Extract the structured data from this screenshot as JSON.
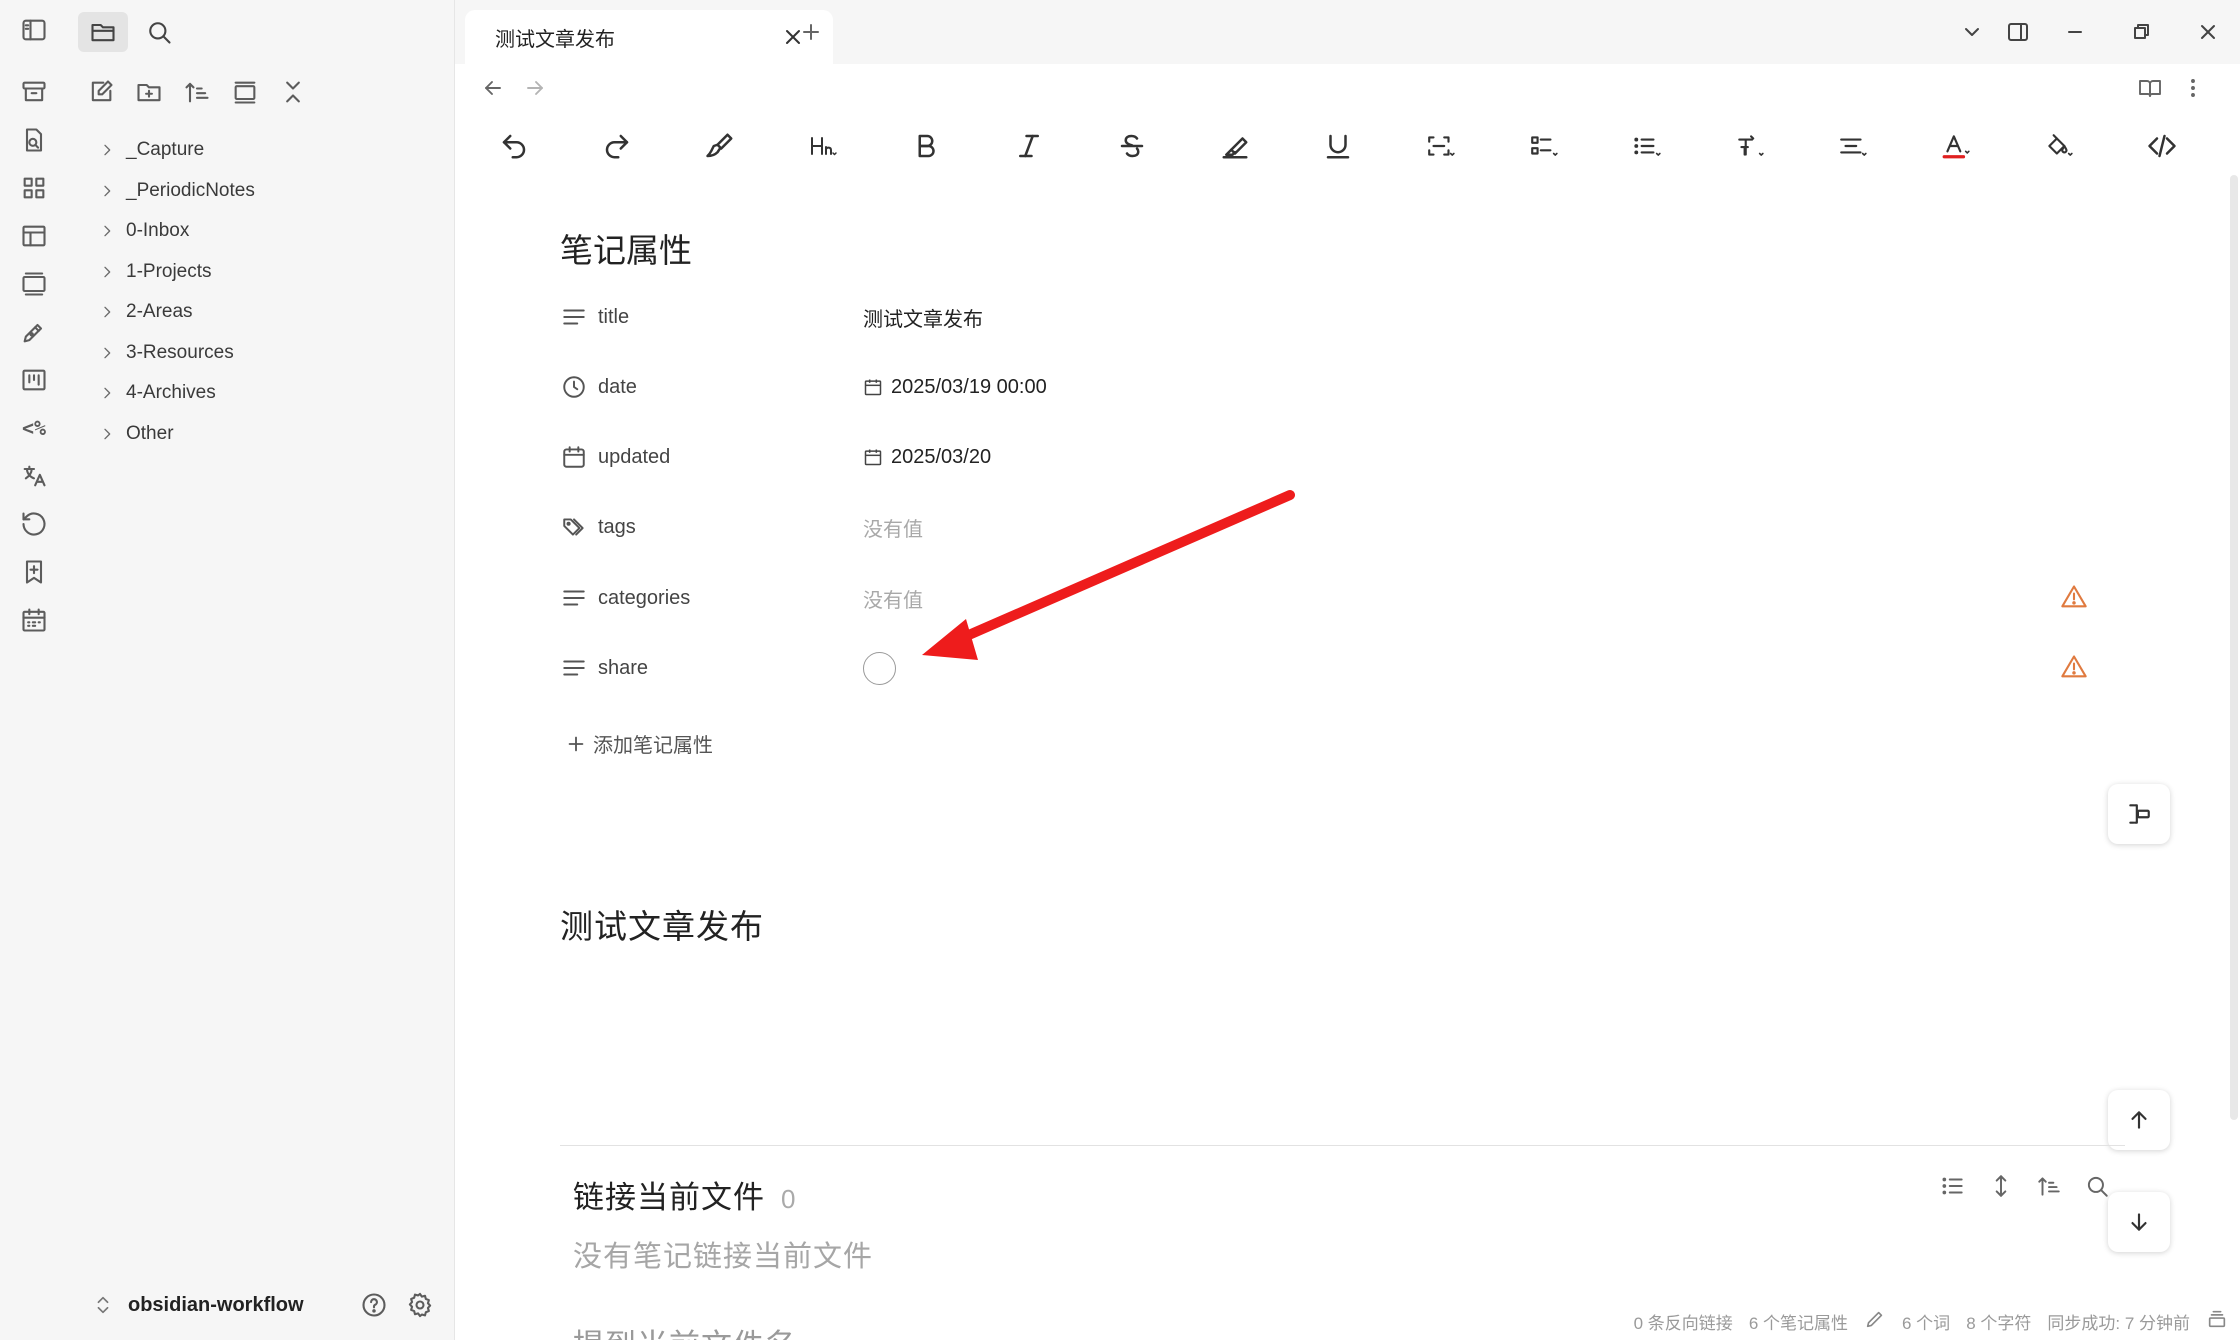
{
  "sidebar": {
    "tree": [
      {
        "label": "_Capture"
      },
      {
        "label": "_PeriodicNotes"
      },
      {
        "label": "0-Inbox"
      },
      {
        "label": "1-Projects"
      },
      {
        "label": "2-Areas"
      },
      {
        "label": "3-Resources"
      },
      {
        "label": "4-Archives"
      },
      {
        "label": "Other"
      }
    ],
    "vault_name": "obsidian-workflow"
  },
  "ribbon": {
    "percent_label": "<%"
  },
  "tabs": {
    "active_title": "测试文章发布"
  },
  "properties": {
    "title": "笔记属性",
    "rows": [
      {
        "key": "title",
        "value": "测试文章发布"
      },
      {
        "key": "date",
        "value": "2025/03/19 00:00"
      },
      {
        "key": "updated",
        "value": "2025/03/20"
      },
      {
        "key": "tags",
        "value": "没有值"
      },
      {
        "key": "categories",
        "value": "没有值"
      },
      {
        "key": "share",
        "value": ""
      }
    ],
    "add_label": "添加笔记属性"
  },
  "document": {
    "heading": "测试文章发布"
  },
  "backlinks": {
    "title": "链接当前文件",
    "count": "0",
    "empty": "没有笔记链接当前文件",
    "mentions_title": "提到当前文件名"
  },
  "statusbar": {
    "backlinks": "0 条反向链接",
    "properties": "6 个笔记属性",
    "words": "6 个词",
    "chars": "8 个字符",
    "sync": "同步成功: 7 分钟前"
  },
  "colors": {
    "annotation_arrow": "#ee1c1c",
    "warning": "#e07a3f",
    "text_color_underline": "#e02020"
  }
}
